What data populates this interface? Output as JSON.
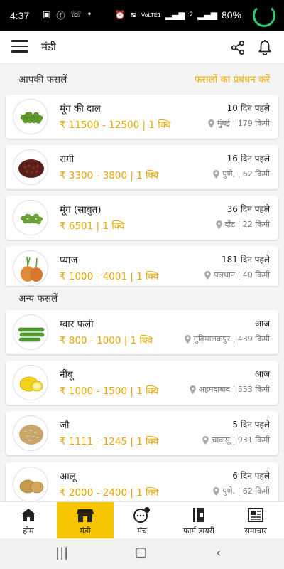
{
  "status_bar": {
    "time": "4:37",
    "battery": "80%",
    "network": "VoLTE1",
    "sim2": "2"
  },
  "app_bar": {
    "title": "मंडी"
  },
  "my_crops": {
    "heading": "आपकी फसलें",
    "manage_link": "फसलों का प्रबंधन करें"
  },
  "other_crops": {
    "heading": "अन्य फसलें"
  },
  "crops": [
    {
      "name": "मूंग की दाल",
      "price": "₹ 11500 - 12500 | 1 क्वि",
      "ago": "10 दिन पहले",
      "location": "मुंबई | 179 किमी",
      "image": "green-gram-dal"
    },
    {
      "name": "रागी",
      "price": "₹ 3300 - 3800 | 1 क्वि",
      "ago": "16 दिन पहले",
      "location": "पुणे, | 62 किमी",
      "image": "ragi-grains"
    },
    {
      "name": "मूंग (साबुत)",
      "price": "₹ 6501 | 1 क्वि",
      "ago": "36 दिन पहले",
      "location": "दौंड | 22 किमी",
      "image": "whole-moong"
    },
    {
      "name": "प्याज",
      "price": "₹ 1000 - 4001 | 1 क्वि",
      "ago": "181 दिन पहले",
      "location": "पलथान | 40 किमी",
      "image": "onion"
    }
  ],
  "other_list": [
    {
      "name": "ग्वार फली",
      "price": "₹ 800 - 1000 | 1 क्वि",
      "ago": "आज",
      "location": "गुढ़िमालकपुर | 439 किमी",
      "image": "cluster-beans"
    },
    {
      "name": "नींबू",
      "price": "₹ 1000 - 1500 | 1 क्वि",
      "ago": "आज",
      "location": "अहमदाबाद | 553 किमी",
      "image": "lemon"
    },
    {
      "name": "जौ",
      "price": "₹ 1111 - 1245 | 1 क्वि",
      "ago": "5 दिन पहले",
      "location": "चाकसू | 931 किमी",
      "image": "barley"
    },
    {
      "name": "आलू",
      "price": "₹ 2000 - 2400 | 1 क्वि",
      "ago": "6 दिन पहले",
      "location": "पुणे, | 62 किमी",
      "image": "potato"
    }
  ],
  "bottom_nav": [
    {
      "label": "होम",
      "icon": "home-icon"
    },
    {
      "label": "मंडी",
      "icon": "store-icon",
      "active": true
    },
    {
      "label": "मंच",
      "icon": "community-icon"
    },
    {
      "label": "फार्म डायरी",
      "icon": "diary-icon"
    },
    {
      "label": "समाचार",
      "icon": "news-icon"
    }
  ],
  "colors": {
    "accent": "#f7c600",
    "price": "#e8a800",
    "link": "#f0b000"
  }
}
